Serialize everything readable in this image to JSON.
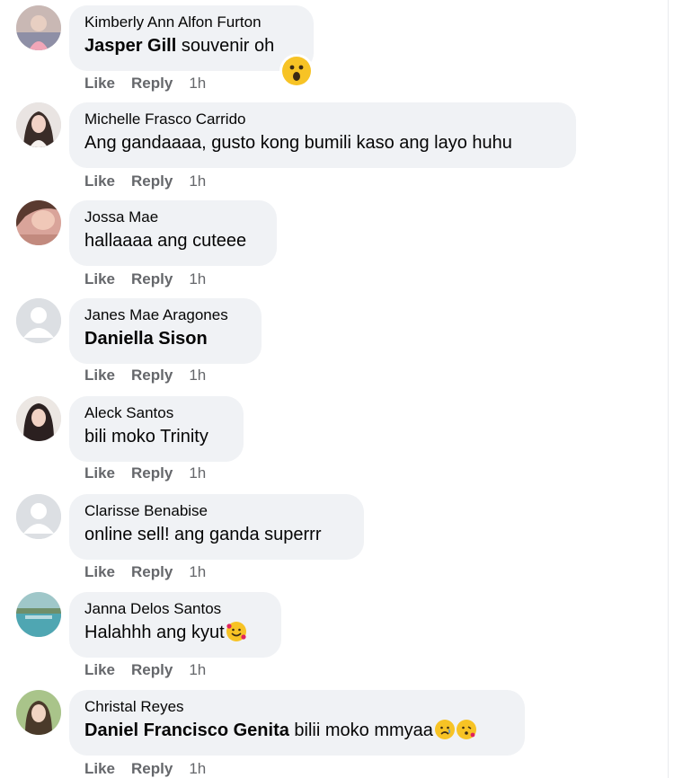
{
  "actions": {
    "like": "Like",
    "reply": "Reply"
  },
  "comments": [
    {
      "author": "Kimberly Ann Alfon Furton",
      "mention": "Jasper Gill",
      "text": " souvenir oh",
      "time": "1h",
      "avatar": "photo-pink",
      "emojis": [
        "surprised-face"
      ]
    },
    {
      "author": "Michelle Frasco Carrido",
      "mention": "",
      "text": "Ang gandaaaa, gusto kong bumili kaso ang layo huhu",
      "time": "1h",
      "avatar": "photo-portrait",
      "emojis": []
    },
    {
      "author": "Jossa Mae",
      "mention": "",
      "text": "hallaaaa ang cuteee",
      "time": "1h",
      "avatar": "photo-warm",
      "emojis": []
    },
    {
      "author": "Janes Mae Aragones",
      "mention": "Daniella Sison",
      "text": "",
      "time": "1h",
      "avatar": "default-silhouette",
      "emojis": []
    },
    {
      "author": "Aleck Santos",
      "mention": "",
      "text": "bili moko Trinity",
      "time": "1h",
      "avatar": "photo-dark-hair",
      "emojis": []
    },
    {
      "author": "Clarisse Benabise",
      "mention": "",
      "text": "online sell! ang ganda superrr",
      "time": "1h",
      "avatar": "default-silhouette",
      "emojis": []
    },
    {
      "author": "Janna Delos Santos",
      "mention": "",
      "text": "Halahhh ang kyut",
      "time": "1h",
      "avatar": "photo-pool",
      "emojis": [
        "smiling-face-with-hearts"
      ]
    },
    {
      "author": "Christal Reyes",
      "mention": "Daniel Francisco Genita",
      "text": " bilii moko mmyaa",
      "time": "1h",
      "avatar": "photo-green",
      "emojis": [
        "sad-face",
        "kissing-face"
      ]
    }
  ],
  "colors": {
    "bubble": "#f0f2f5",
    "meta": "#65676b",
    "text": "#050505"
  }
}
